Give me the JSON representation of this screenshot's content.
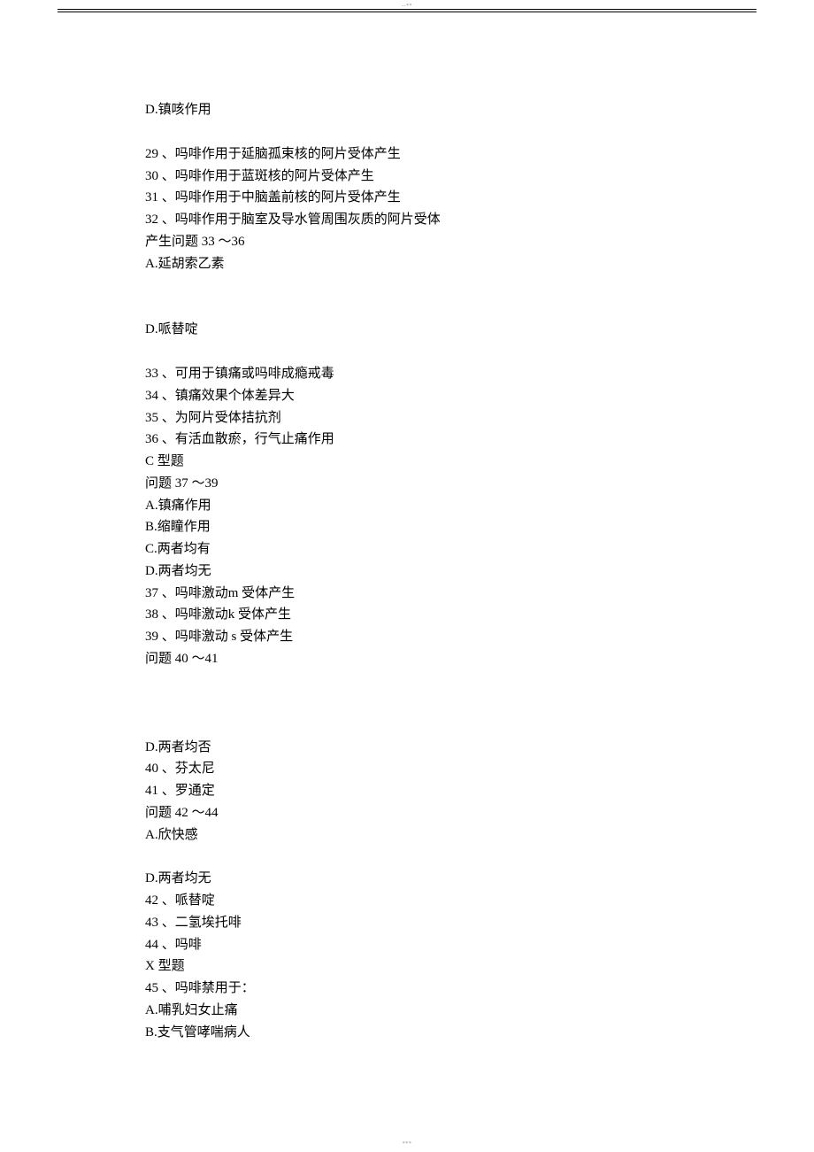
{
  "header_marker": "--**",
  "footer_marker": "***",
  "lines": {
    "l0": "D.镇咳作用",
    "l1": "29 、吗啡作用于延脑孤束核的阿片受体产生",
    "l2": "30 、吗啡作用于蓝斑核的阿片受体产生",
    "l3": "31 、吗啡作用于中脑盖前核的阿片受体产生",
    "l4": "32 、吗啡作用于脑室及导水管周围灰质的阿片受体",
    "l5": "产生问题 33 ～36",
    "l6": "A.延胡索乙素",
    "l7": "D.哌替啶",
    "l8": "33 、可用于镇痛或吗啡成瘾戒毒",
    "l9": "34 、镇痛效果个体差异大",
    "l10": "35 、为阿片受体拮抗剂",
    "l11": "36 、有活血散瘀，行气止痛作用",
    "l12": "C 型题",
    "l13": "问题 37 ～39",
    "l14": "A.镇痛作用",
    "l15": "B.缩瞳作用",
    "l16": "C.两者均有",
    "l17": "D.两者均无",
    "l18": "37 、吗啡激动m 受体产生",
    "l19": "38 、吗啡激动k 受体产生",
    "l20": "39 、吗啡激动 s 受体产生",
    "l21": "问题 40 ～41",
    "l22": "D.两者均否",
    "l23": "40 、芬太尼",
    "l24": "41 、罗通定",
    "l25": "问题 42 ～44",
    "l26": "A.欣快感",
    "l27": "D.两者均无",
    "l28": "42 、哌替啶",
    "l29": "43 、二氢埃托啡",
    "l30": "44 、吗啡",
    "l31": "X 型题",
    "l32": "45 、吗啡禁用于：",
    "l33": "A.哺乳妇女止痛",
    "l34": "B.支气管哮喘病人"
  }
}
